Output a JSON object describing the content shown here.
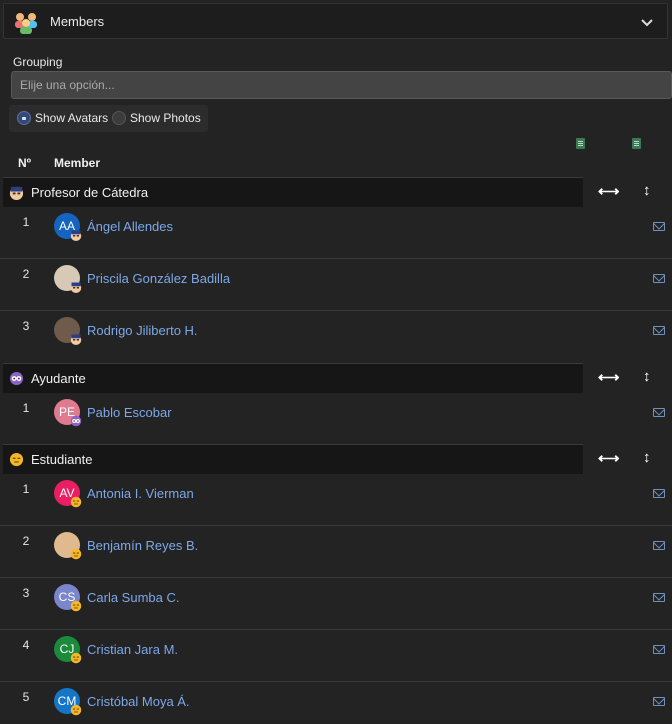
{
  "header": {
    "title": "Members"
  },
  "grouping": {
    "label": "Grouping",
    "placeholder": "Elije una opción..."
  },
  "toggles": {
    "avatars": "Show Avatars",
    "photos": "Show Photos",
    "selected": "avatars"
  },
  "table": {
    "col_num": "Nº",
    "col_member": "Member"
  },
  "groups": [
    {
      "name": "Profesor de Cátedra",
      "badge": "teacher",
      "members": [
        {
          "num": "1",
          "initials": "AA",
          "name": "Ángel Allendes",
          "color": "#1565c0",
          "photo": false
        },
        {
          "num": "2",
          "initials": "",
          "name": "Priscila González Badilla",
          "color": "#d8c9b6",
          "photo": true
        },
        {
          "num": "3",
          "initials": "",
          "name": "Rodrigo Jiliberto H.",
          "color": "#6f5b4c",
          "photo": true
        }
      ]
    },
    {
      "name": "Ayudante",
      "badge": "assistant",
      "members": [
        {
          "num": "1",
          "initials": "PE",
          "name": "Pablo Escobar",
          "color": "#e07a90",
          "photo": false
        }
      ]
    },
    {
      "name": "Estudiante",
      "badge": "student",
      "members": [
        {
          "num": "1",
          "initials": "AV",
          "name": "Antonia I. Vierman",
          "color": "#e91e63",
          "photo": false
        },
        {
          "num": "2",
          "initials": "",
          "name": "Benjamín Reyes B.",
          "color": "#e0b98f",
          "photo": true
        },
        {
          "num": "3",
          "initials": "CS",
          "name": "Carla Sumba C.",
          "color": "#7986cb",
          "photo": false
        },
        {
          "num": "4",
          "initials": "CJ",
          "name": "Cristian Jara M.",
          "color": "#1b8a3a",
          "photo": false
        },
        {
          "num": "5",
          "initials": "CM",
          "name": "Cristóbal Moya Á.",
          "color": "#1576c8",
          "photo": false
        }
      ]
    }
  ]
}
